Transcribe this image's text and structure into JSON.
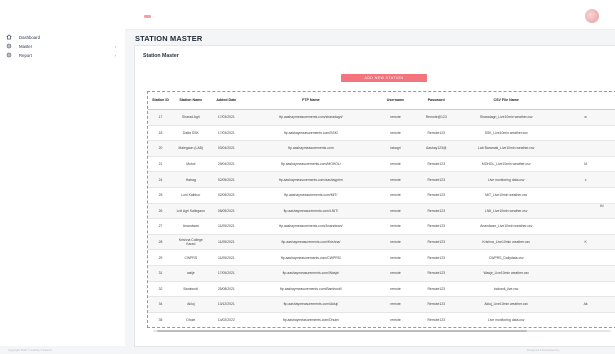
{
  "sidebar": {
    "items": [
      {
        "label": "Dashboard",
        "icon": "home-icon",
        "has_submenu": false
      },
      {
        "label": "Master",
        "icon": "settings-icon",
        "has_submenu": true
      },
      {
        "label": "Report",
        "icon": "settings-icon",
        "has_submenu": true
      }
    ]
  },
  "header": {
    "title": "STATION MASTER"
  },
  "card": {
    "title": "Station Master",
    "add_button": "ADD NEW STATION"
  },
  "table": {
    "columns": [
      "Station ID",
      "Station Name",
      "Added Date",
      "FTP Name",
      "Username",
      "Password",
      "CSV File Name",
      ""
    ],
    "rows": [
      [
        "17",
        "Sharad Agri",
        "17/03/2021",
        "ftp.aashaymeasurements.com/sharadagri/",
        "remote",
        "Remote@123",
        "Sharadagri_Live10min weather.csv",
        "w"
      ],
      [
        "18",
        "Datta SSK",
        "17/03/2021",
        "ftp.aashaymeasurements.com/SSK/",
        "remote",
        "Remote123",
        "SSK_Live10min weather.csv",
        ""
      ],
      [
        "20",
        "Malegaon (LAB)",
        "03/04/2021",
        "ftp.aashaymeasurements.com",
        "labagri",
        "Aashay123@",
        "Lab Baramati_Live10min weather.csv",
        ""
      ],
      [
        "21",
        "Mohol",
        "29/04/2021",
        "ftp.aashaymeasurements.com/MOHOL/",
        "remote",
        "Remote123",
        "MOHOL_Live10min weather.csv",
        "M"
      ],
      [
        "24",
        "Hatrag",
        "02/05/2021",
        "ftp.aashaymeasurements.com/aashayprim",
        "remote",
        "Remote123",
        "Live monitoring data.csv",
        "c"
      ],
      [
        "25",
        "Loni Kalbhor",
        "02/05/2021",
        "ftp.aashaymeasurements.com/MIT/",
        "remote",
        "Remote123",
        "MIT_Live10min weather.csv",
        ""
      ],
      [
        "26",
        "Lnit Agri Kallegaon",
        "08/05/2021",
        "ftp.aashaymeasurements.com/LNIT/",
        "remote",
        "Remote123",
        "LNIt_Live10min weather.csv",
        ""
      ],
      [
        "27",
        "Anandwan",
        "11/05/2021",
        "ftp.aashaymeasurements.com/Anandwan/",
        "remote",
        "Remote123",
        "Anandwan_Live10min weather.csv",
        ""
      ],
      [
        "28",
        "Krishna College Karad",
        "11/05/2021",
        "ftp.aashaymeasurements.com/Krishna/",
        "remote",
        "Remote123",
        "Krishna_Live10min weather.csv",
        "K"
      ],
      [
        "29",
        "CWPRS",
        "11/05/2021",
        "ftp.aashaymeasurements.com/CWPRS/",
        "remote",
        "Remote123",
        "CWPRS_Dailydata.csv",
        ""
      ],
      [
        "31",
        "waije",
        "17/05/2021",
        "ftp.aashaymeasurements.com/Wasje/",
        "remote",
        "Remote123",
        "Wasje_Live10min weather.csv",
        ""
      ],
      [
        "32",
        "Bamburdi",
        "25/08/2021",
        "ftp.aashaymeasurements.com/Bamburdi/",
        "remote",
        "Remote123",
        "baburdi_live.csv",
        ""
      ],
      [
        "34",
        "Akluj",
        "13/12/2021",
        "ftp.aashaymeasurements.com/Akluj/",
        "remote",
        "Remote123",
        "Akluj_Live10min weather.csv",
        "Ak"
      ],
      [
        "35",
        "Dhule",
        "14/02/2022",
        "ftp.aashaymeasurements.com/Dhule/",
        "remote",
        "Remote123",
        "Live monitoring data.csv",
        ""
      ]
    ]
  },
  "floating_tab": "tN",
  "footer": {
    "left": "Copyright 2022 © Aashay Infratech",
    "right": "Designed & Developed by"
  },
  "colors": {
    "accent": "#f4747e",
    "sidebar_bg": "#ffffff",
    "page_bg": "#f4f5f7"
  }
}
